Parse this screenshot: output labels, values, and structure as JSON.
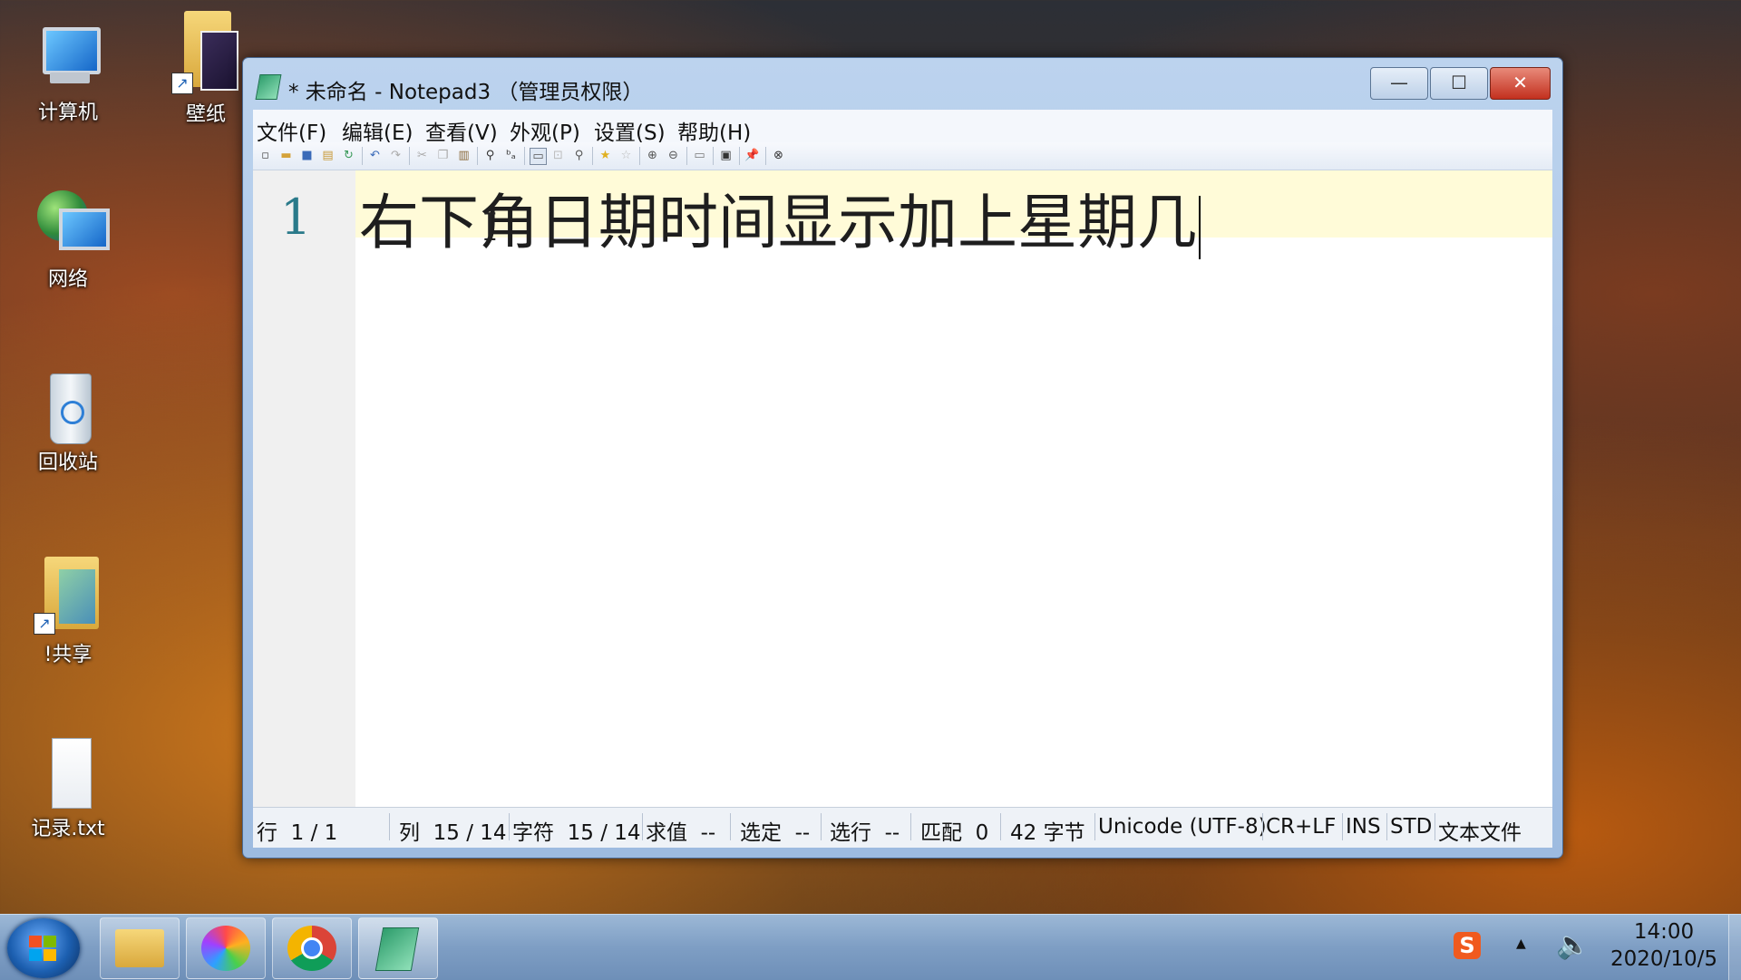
{
  "desktop": {
    "icons": [
      {
        "label": "计算机",
        "icon": "computer-icon"
      },
      {
        "label": "壁纸",
        "icon": "folder-shortcut-icon"
      },
      {
        "label": "网络",
        "icon": "network-icon"
      },
      {
        "label": "回收站",
        "icon": "recycle-bin-icon"
      },
      {
        "label": "!共享",
        "icon": "folder-shortcut-icon"
      },
      {
        "label": "记录.txt",
        "icon": "text-file-icon"
      }
    ]
  },
  "window": {
    "title": "* 未命名 - Notepad3 （管理员权限）",
    "buttons": {
      "minimize": "—",
      "maximize": "☐",
      "close": "✕"
    },
    "menu": [
      "文件(F)",
      "编辑(E)",
      "查看(V)",
      "外观(P)",
      "设置(S)",
      "帮助(H)"
    ],
    "editor": {
      "line_number": "1",
      "text": "右下角日期时间显示加上星期几"
    },
    "status": {
      "line": "行  1 / 1",
      "col": "列  15 / 14",
      "char": "字符  15 / 14",
      "eval": "求值  --",
      "sel": "选定  --",
      "sel_lines": "选行  --",
      "match": "匹配  0",
      "bytes": "42 字节",
      "encoding": "Unicode (UTF-8)",
      "eol": "CR+LF",
      "ins": "INS",
      "std": "STD",
      "type": "文本文件"
    }
  },
  "taskbar": {
    "apps": [
      "file-explorer-icon",
      "pinwheel-app-icon",
      "chrome-icon",
      "notepad3-icon"
    ],
    "tray": {
      "ime": "S",
      "arrow": "▲",
      "time": "14:00",
      "date": "2020/10/5"
    }
  }
}
